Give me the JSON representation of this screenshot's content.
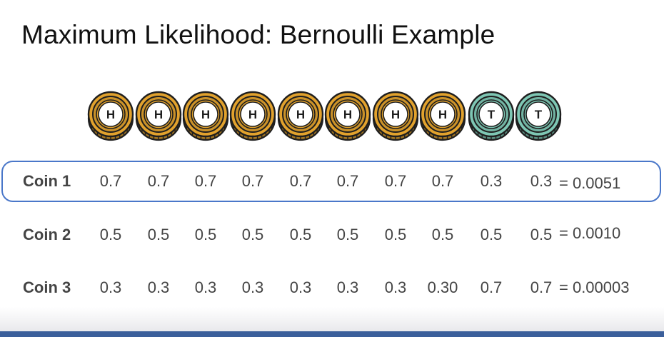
{
  "slide": {
    "title": "Maximum Likelihood: Bernoulli Example"
  },
  "coins": [
    {
      "face": "H",
      "color": "#e2a22d"
    },
    {
      "face": "H",
      "color": "#e2a22d"
    },
    {
      "face": "H",
      "color": "#e2a22d"
    },
    {
      "face": "H",
      "color": "#e2a22d"
    },
    {
      "face": "H",
      "color": "#e2a22d"
    },
    {
      "face": "H",
      "color": "#e2a22d"
    },
    {
      "face": "H",
      "color": "#e2a22d"
    },
    {
      "face": "H",
      "color": "#e2a22d"
    },
    {
      "face": "T",
      "color": "#7ec7b4"
    },
    {
      "face": "T",
      "color": "#7ec7b4"
    }
  ],
  "rows": [
    {
      "label": "Coin 1",
      "probs": [
        "0.7",
        "0.7",
        "0.7",
        "0.7",
        "0.7",
        "0.7",
        "0.7",
        "0.7",
        "0.3",
        "0.3"
      ],
      "result": "= 0.0051",
      "highlighted": true
    },
    {
      "label": "Coin 2",
      "probs": [
        "0.5",
        "0.5",
        "0.5",
        "0.5",
        "0.5",
        "0.5",
        "0.5",
        "0.5",
        "0.5",
        "0.5"
      ],
      "result": "= 0.0010",
      "highlighted": false
    },
    {
      "label": "Coin 3",
      "probs": [
        "0.3",
        "0.3",
        "0.3",
        "0.3",
        "0.3",
        "0.3",
        "0.3",
        "0.30",
        "0.7",
        "0.7"
      ],
      "result": "= 0.00003",
      "highlighted": false
    }
  ],
  "colors": {
    "highlight_border": "#4a77c9",
    "bottom_bar": "#3b5f9b"
  }
}
